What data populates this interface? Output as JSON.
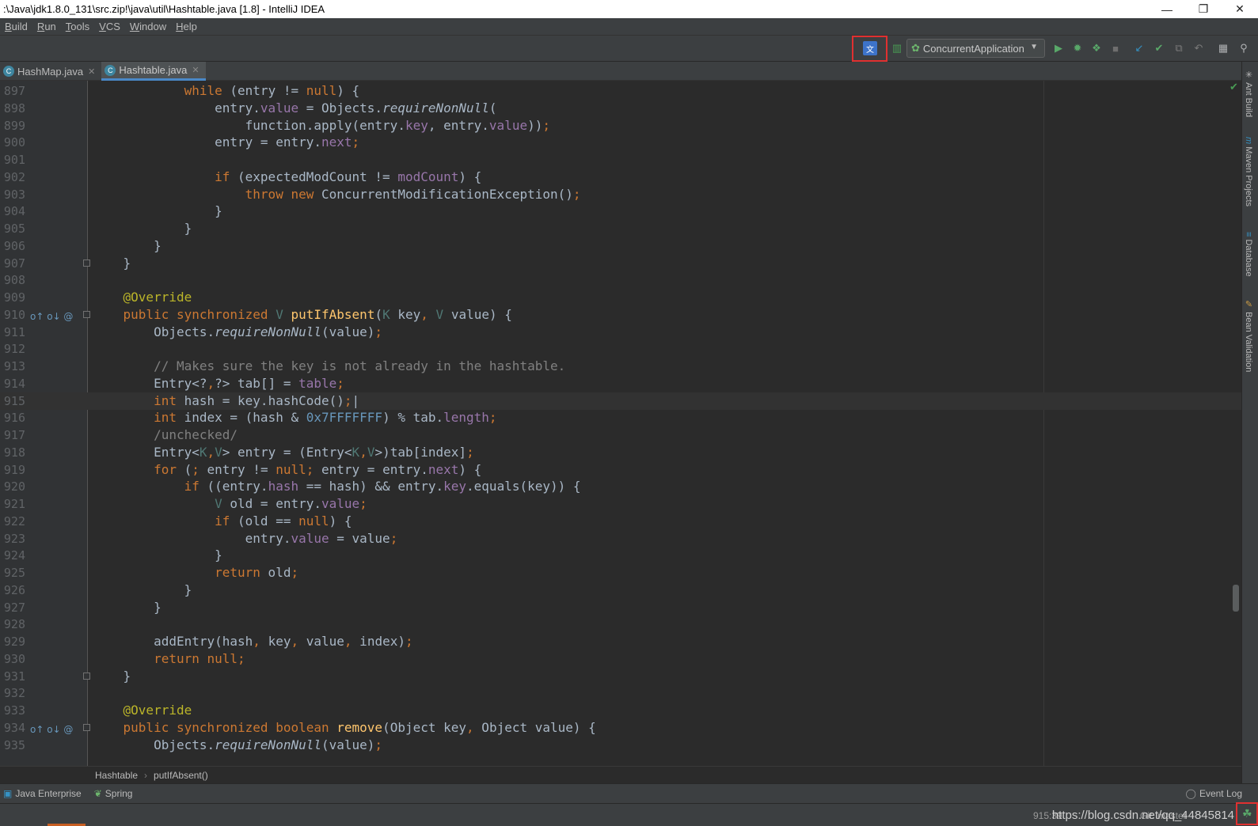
{
  "window": {
    "title": ":\\Java\\jdk1.8.0_131\\src.zip!\\java\\util\\Hashtable.java [1.8] - IntelliJ IDEA",
    "controls": [
      "—",
      "❐",
      "✕"
    ]
  },
  "menu": [
    "Build",
    "Run",
    "Tools",
    "VCS",
    "Window",
    "Help"
  ],
  "toolbar": {
    "run_config": "ConcurrentApplication",
    "icons": [
      "translate-icon",
      "build-icon",
      "run-config-icon",
      "run-icon",
      "debug-icon",
      "coverage-icon",
      "stop-icon",
      "vcs-update-icon",
      "vcs-commit-icon",
      "history-icon",
      "revert-icon",
      "project-structure-icon",
      "search-icon"
    ]
  },
  "tabs": [
    {
      "label": "HashMap.java",
      "active": false
    },
    {
      "label": "Hashtable.java",
      "active": true
    }
  ],
  "code": [
    {
      "n": "897",
      "h": "            <span class=\"kw\">while</span> (entry != <span class=\"kw\">null</span>) {"
    },
    {
      "n": "898",
      "h": "                entry.<span class=\"fld\">value</span> = Objects.<span class=\"ital\">requireNonNull</span>("
    },
    {
      "n": "899",
      "h": "                    function.apply(entry.<span class=\"fld\">key</span>, entry.<span class=\"fld\">value</span>))<span class=\"kw\">;</span>"
    },
    {
      "n": "900",
      "h": "                entry = entry.<span class=\"fld\">next</span><span class=\"kw\">;</span>"
    },
    {
      "n": "901",
      "h": ""
    },
    {
      "n": "902",
      "h": "                <span class=\"kw\">if</span> (expectedModCount != <span class=\"fld\">modCount</span>) {"
    },
    {
      "n": "903",
      "h": "                    <span class=\"kw\">throw new</span> ConcurrentModificationException()<span class=\"kw\">;</span>"
    },
    {
      "n": "904",
      "h": "                }"
    },
    {
      "n": "905",
      "h": "            }"
    },
    {
      "n": "906",
      "h": "        }"
    },
    {
      "n": "907",
      "h": "    }",
      "fold": true
    },
    {
      "n": "908",
      "h": ""
    },
    {
      "n": "909",
      "h": "    <span class=\"ann\">@Override</span>"
    },
    {
      "n": "910",
      "h": "    <span class=\"kw\">public synchronized</span> <span class=\"gen\">V</span> <span class=\"fn\">putIfAbsent</span>(<span class=\"gen\">K</span> key<span class=\"kw\">,</span> <span class=\"gen\">V</span> value) {",
      "mark": "o↑ o↓ @",
      "fold": true
    },
    {
      "n": "911",
      "h": "        Objects.<span class=\"ital\">requireNonNull</span>(value)<span class=\"kw\">;</span>"
    },
    {
      "n": "912",
      "h": ""
    },
    {
      "n": "913",
      "h": "        <span class=\"cmt\">// Makes sure the key is not already in the hashtable.</span>"
    },
    {
      "n": "914",
      "h": "        Entry&lt;?<span class=\"kw\">,</span>?&gt; tab[] = <span class=\"fld\">table</span><span class=\"kw\">;</span>"
    },
    {
      "n": "915",
      "h": "        <span class=\"kw\">int</span> hash = key.hashCode()<span class=\"kw\">;</span>|",
      "cur": true
    },
    {
      "n": "916",
      "h": "        <span class=\"kw\">int</span> index = (hash &amp; <span class=\"num\">0x7FFFFFFF</span>) % tab.<span class=\"fld\">length</span><span class=\"kw\">;</span>"
    },
    {
      "n": "917",
      "h": "        <span class=\"cmt\">/unchecked/</span>"
    },
    {
      "n": "918",
      "h": "        Entry&lt;<span class=\"gen\">K</span><span class=\"kw\">,</span><span class=\"gen\">V</span>&gt; entry = (Entry&lt;<span class=\"gen\">K</span><span class=\"kw\">,</span><span class=\"gen\">V</span>&gt;)tab[index]<span class=\"kw\">;</span>"
    },
    {
      "n": "919",
      "h": "        <span class=\"kw\">for</span> (<span class=\"kw\">;</span> entry != <span class=\"kw\">null;</span> entry = entry.<span class=\"fld\">next</span>) {"
    },
    {
      "n": "920",
      "h": "            <span class=\"kw\">if</span> ((entry.<span class=\"fld\">hash</span> == hash) &amp;&amp; entry.<span class=\"fld\">key</span>.equals(key)) {"
    },
    {
      "n": "921",
      "h": "                <span class=\"gen\">V</span> old = entry.<span class=\"fld\">value</span><span class=\"kw\">;</span>"
    },
    {
      "n": "922",
      "h": "                <span class=\"kw\">if</span> (old == <span class=\"kw\">null</span>) {"
    },
    {
      "n": "923",
      "h": "                    entry.<span class=\"fld\">value</span> = value<span class=\"kw\">;</span>"
    },
    {
      "n": "924",
      "h": "                }"
    },
    {
      "n": "925",
      "h": "                <span class=\"kw\">return</span> old<span class=\"kw\">;</span>"
    },
    {
      "n": "926",
      "h": "            }"
    },
    {
      "n": "927",
      "h": "        }"
    },
    {
      "n": "928",
      "h": ""
    },
    {
      "n": "929",
      "h": "        addEntry(hash<span class=\"kw\">,</span> key<span class=\"kw\">,</span> value<span class=\"kw\">,</span> index)<span class=\"kw\">;</span>"
    },
    {
      "n": "930",
      "h": "        <span class=\"kw\">return null;</span>"
    },
    {
      "n": "931",
      "h": "    }",
      "fold": true
    },
    {
      "n": "932",
      "h": ""
    },
    {
      "n": "933",
      "h": "    <span class=\"ann\">@Override</span>"
    },
    {
      "n": "934",
      "h": "    <span class=\"kw\">public synchronized boolean</span> <span class=\"fn\">remove</span>(Object key<span class=\"kw\">,</span> Object value) {",
      "mark": "o↑ o↓ @",
      "fold": true
    },
    {
      "n": "935",
      "h": "        Objects.<span class=\"ital\">requireNonNull</span>(value)<span class=\"kw\">;</span>"
    }
  ],
  "breadcrumb": [
    "Hashtable",
    "putIfAbsent()"
  ],
  "bottom_tools": [
    "Java Enterprise",
    "Spring"
  ],
  "event_log": "Event Log",
  "status": {
    "position": "915:39",
    "watermark": "https://blog.csdn.net/qq_44845814",
    "extra": "Git: master"
  },
  "right_tools": [
    "Ant Build",
    "Maven Projects",
    "Database",
    "Bean Validation"
  ]
}
